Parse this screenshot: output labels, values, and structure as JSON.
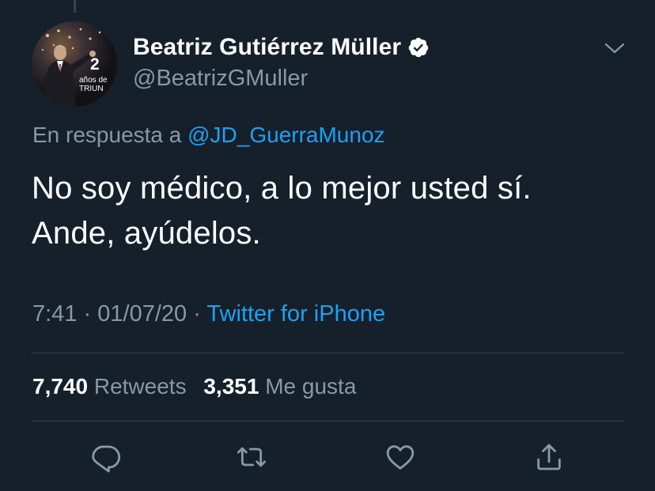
{
  "colors": {
    "background": "#15202b",
    "primary_text": "#ffffff",
    "secondary_text": "#8899a6",
    "link": "#1da1f2",
    "divider": "#38444d"
  },
  "author": {
    "display_name": "Beatriz Gutiérrez Müller",
    "handle": "@BeatrizGMuller",
    "verified_icon": "verified-badge-icon",
    "avatar": {
      "description_icon": "profile-photo",
      "overlay_big": "2",
      "overlay_line1": "años de",
      "overlay_line2": "TRIUN"
    }
  },
  "menu_icon": "chevron-down-icon",
  "reply": {
    "prefix": "En respuesta a",
    "mention": "@JD_GuerraMunoz"
  },
  "tweet": {
    "line1": "No soy médico, a lo mejor usted sí.",
    "line2": "Ande, ayúdelos."
  },
  "meta": {
    "time": "7:41",
    "separator": "·",
    "date": "01/07/20",
    "source": "Twitter for iPhone"
  },
  "stats": {
    "retweets_count": "7,740",
    "retweets_label": "Retweets",
    "likes_count": "3,351",
    "likes_label": "Me gusta"
  },
  "actions": [
    {
      "icon": "reply-icon"
    },
    {
      "icon": "retweet-icon"
    },
    {
      "icon": "like-heart-icon"
    },
    {
      "icon": "share-icon"
    }
  ]
}
